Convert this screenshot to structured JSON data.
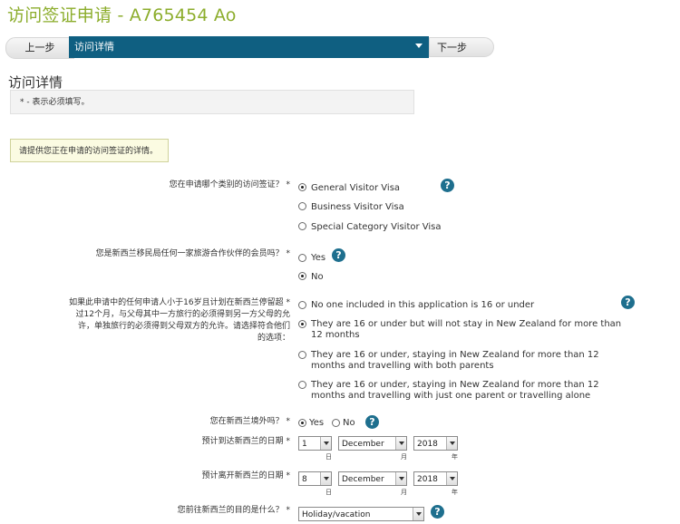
{
  "page": {
    "title": "访问签证申请 - A765454 Ao"
  },
  "nav": {
    "prev_label": "上一步",
    "current_label": "访问详情",
    "next_label": "下一步"
  },
  "section": {
    "title": "访问详情",
    "required_note": "* - 表示必须填写。",
    "info_note": "请提供您正在申请的访问签证的详情。"
  },
  "icons": {
    "help": "help-icon"
  },
  "questions": {
    "visa_category": {
      "label": "您在申请哪个类别的访问签证？ *",
      "options": [
        {
          "label": "General Visitor Visa",
          "checked": true
        },
        {
          "label": "Business Visitor Visa",
          "checked": false
        },
        {
          "label": "Special Category Visitor Visa",
          "checked": false
        }
      ]
    },
    "partner_member": {
      "label": "您是新西兰移民局任何一家旅游合作伙伴的会员吗？ *",
      "options": [
        {
          "label": "Yes",
          "checked": false
        },
        {
          "label": "No",
          "checked": true
        }
      ]
    },
    "under16": {
      "label_lines": [
        "如果此申请中的任何申请人小于16岁且计划在新西兰停留超 *",
        "过12个月，与父母其中一方旅行的必须得到另一方父母的允",
        "许，单独旅行的必须得到父母双方的允许。请选择符合他们",
        "的选项："
      ],
      "options": [
        {
          "lines": [
            "No one included in this application is 16 or under"
          ],
          "checked": false
        },
        {
          "lines": [
            "They are 16 or under but will not stay in New Zealand for more than",
            "12 months"
          ],
          "checked": true
        },
        {
          "lines": [
            "They are 16 or under, staying in New Zealand for more than 12",
            "months and travelling with both parents"
          ],
          "checked": false
        },
        {
          "lines": [
            "They are 16 or under, staying in New Zealand for more than 12",
            "months and travelling with just one parent or travelling alone"
          ],
          "checked": false
        }
      ]
    },
    "outside_nz": {
      "label": "您在新西兰境外吗？ *",
      "options": [
        {
          "label": "Yes",
          "checked": true
        },
        {
          "label": "No",
          "checked": false
        }
      ]
    },
    "arrival_date": {
      "label": "预计到达新西兰的日期 *",
      "day": "1",
      "month": "December",
      "year": "2018",
      "units": {
        "day": "日",
        "month": "月",
        "year": "年"
      }
    },
    "departure_date": {
      "label": "预计离开新西兰的日期 *",
      "day": "8",
      "month": "December",
      "year": "2018",
      "units": {
        "day": "日",
        "month": "月",
        "year": "年"
      }
    },
    "purpose": {
      "label": "您前往新西兰的目的是什么？ *",
      "value": "Holiday/vacation"
    }
  }
}
